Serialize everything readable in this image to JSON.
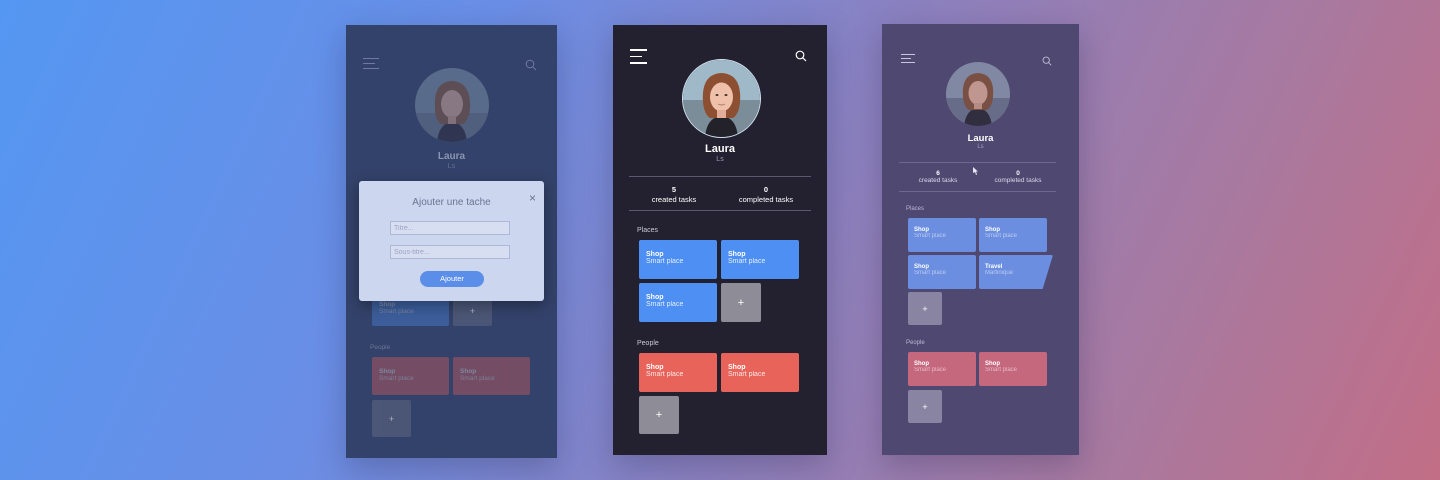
{
  "colors": {
    "blue_card": "#4d8ff2",
    "red_card": "#e8645a",
    "gray_add": "#8e8d97"
  },
  "screens": [
    {
      "profile": {
        "name": "Laura",
        "handle": "Ls"
      },
      "modal": {
        "title": "Ajouter une tache",
        "title_placeholder": "Titre...",
        "subtitle_placeholder": "Sous-titre...",
        "submit_label": "Ajouter",
        "close_icon": "×"
      },
      "places": {
        "cards": [
          {
            "title": "Shop",
            "subtitle": "Smart place"
          }
        ]
      },
      "people": {
        "label": "People",
        "cards": [
          {
            "title": "Shop",
            "subtitle": "Smart place"
          },
          {
            "title": "Shop",
            "subtitle": "Smart place"
          }
        ]
      },
      "add_label": "+"
    },
    {
      "profile": {
        "name": "Laura",
        "handle": "Ls"
      },
      "stats": [
        {
          "value": "5",
          "label": "created tasks"
        },
        {
          "value": "0",
          "label": "completed tasks"
        }
      ],
      "places": {
        "label": "Places",
        "cards": [
          {
            "title": "Shop",
            "subtitle": "Smart place"
          },
          {
            "title": "Shop",
            "subtitle": "Smart place"
          },
          {
            "title": "Shop",
            "subtitle": "Smart place"
          }
        ]
      },
      "people": {
        "label": "People",
        "cards": [
          {
            "title": "Shop",
            "subtitle": "Smart place"
          },
          {
            "title": "Shop",
            "subtitle": "Smart place"
          }
        ]
      },
      "add_label": "+"
    },
    {
      "profile": {
        "name": "Laura",
        "handle": "Ls"
      },
      "stats": [
        {
          "value": "6",
          "label": "created tasks"
        },
        {
          "value": "0",
          "label": "completed tasks"
        }
      ],
      "places": {
        "label": "Places",
        "cards": [
          {
            "title": "Shop",
            "subtitle": "Smart place"
          },
          {
            "title": "Shop",
            "subtitle": "Smart place"
          },
          {
            "title": "Shop",
            "subtitle": "Smart place"
          },
          {
            "title": "Travel",
            "subtitle": "Martinique"
          }
        ]
      },
      "people": {
        "label": "People",
        "cards": [
          {
            "title": "Shop",
            "subtitle": "Smart place"
          },
          {
            "title": "Shop",
            "subtitle": "Smart place"
          }
        ]
      },
      "add_label": "+"
    }
  ]
}
